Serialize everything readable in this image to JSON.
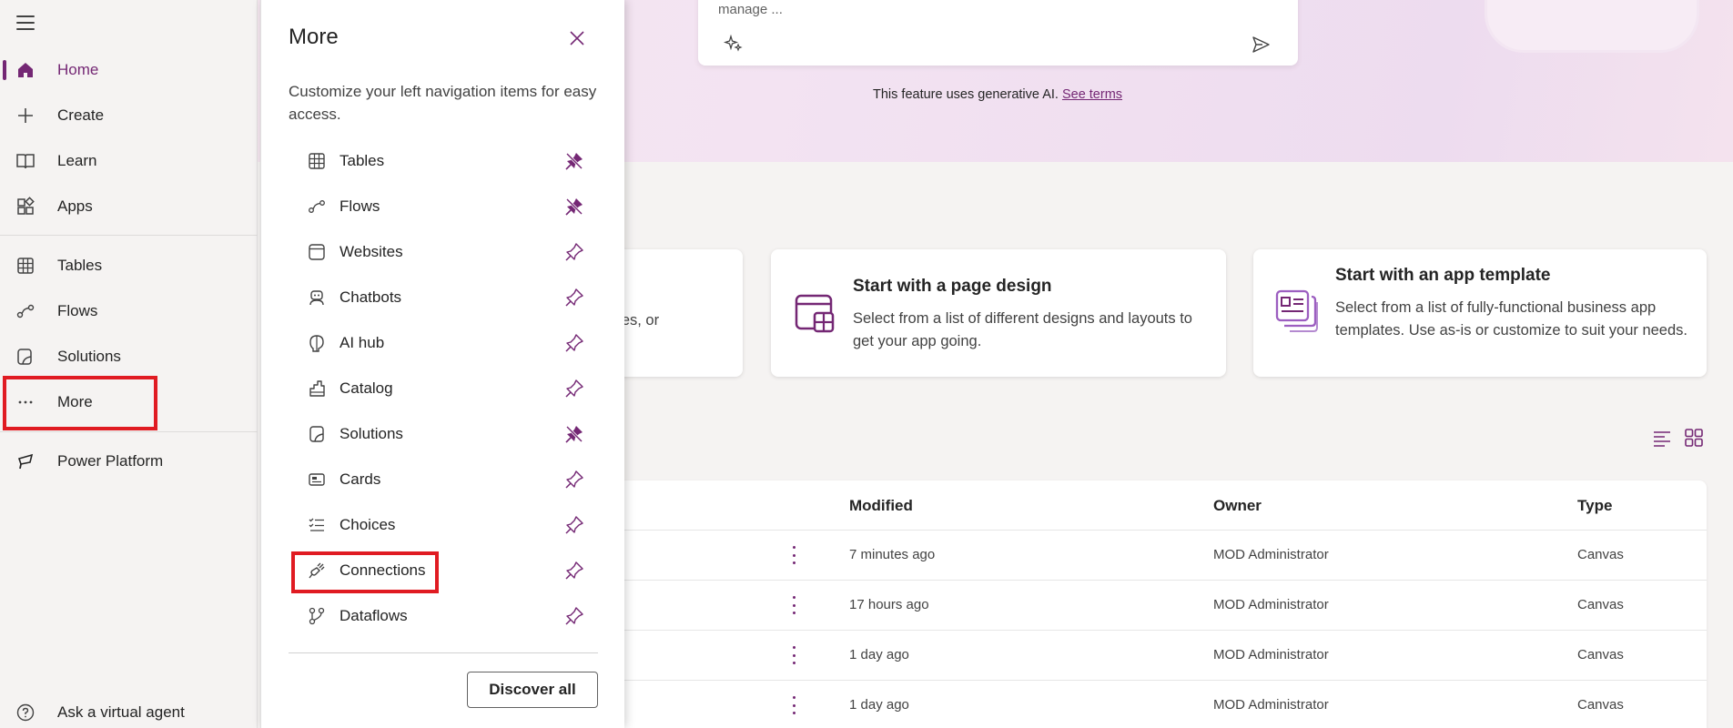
{
  "leftnav": {
    "items": [
      {
        "label": "Home",
        "icon": "home-icon"
      },
      {
        "label": "Create",
        "icon": "plus-icon"
      },
      {
        "label": "Learn",
        "icon": "book-icon"
      },
      {
        "label": "Apps",
        "icon": "apps-icon"
      },
      {
        "label": "Tables",
        "icon": "table-icon"
      },
      {
        "label": "Flows",
        "icon": "flow-icon"
      },
      {
        "label": "Solutions",
        "icon": "solutions-icon"
      },
      {
        "label": "More",
        "icon": "more-icon"
      },
      {
        "label": "Power Platform",
        "icon": "power-platform-icon"
      }
    ],
    "virtual_agent": "Ask a virtual agent"
  },
  "hero": {
    "prompt_text": "manage ...",
    "ai_note": "This feature uses generative AI.",
    "ai_link": "See terms"
  },
  "cards": [
    {
      "title": "",
      "desc": "bles, or"
    },
    {
      "title": "Start with a page design",
      "desc": "Select from a list of different designs and layouts to get your app going."
    },
    {
      "title": "Start with an app template",
      "desc": "Select from a list of fully-functional business app templates. Use as-is or customize to suit your needs."
    }
  ],
  "table": {
    "headers": {
      "modified": "Modified",
      "owner": "Owner",
      "type": "Type"
    },
    "rows": [
      {
        "modified": "7 minutes ago",
        "owner": "MOD Administrator",
        "type": "Canvas"
      },
      {
        "modified": "17 hours ago",
        "owner": "MOD Administrator",
        "type": "Canvas"
      },
      {
        "modified": "1 day ago",
        "owner": "MOD Administrator",
        "type": "Canvas"
      },
      {
        "modified": "1 day ago",
        "owner": "MOD Administrator",
        "type": "Canvas"
      }
    ]
  },
  "flyout": {
    "title": "More",
    "description": "Customize your left navigation items for easy access.",
    "items": [
      {
        "label": "Tables",
        "pinned": true
      },
      {
        "label": "Flows",
        "pinned": true
      },
      {
        "label": "Websites",
        "pinned": false
      },
      {
        "label": "Chatbots",
        "pinned": false
      },
      {
        "label": "AI hub",
        "pinned": false
      },
      {
        "label": "Catalog",
        "pinned": false
      },
      {
        "label": "Solutions",
        "pinned": true
      },
      {
        "label": "Cards",
        "pinned": false
      },
      {
        "label": "Choices",
        "pinned": false
      },
      {
        "label": "Connections",
        "pinned": false
      },
      {
        "label": "Dataflows",
        "pinned": false
      }
    ],
    "discover_all": "Discover all"
  },
  "colors": {
    "accent": "#742774",
    "highlight": "#e01b22"
  }
}
